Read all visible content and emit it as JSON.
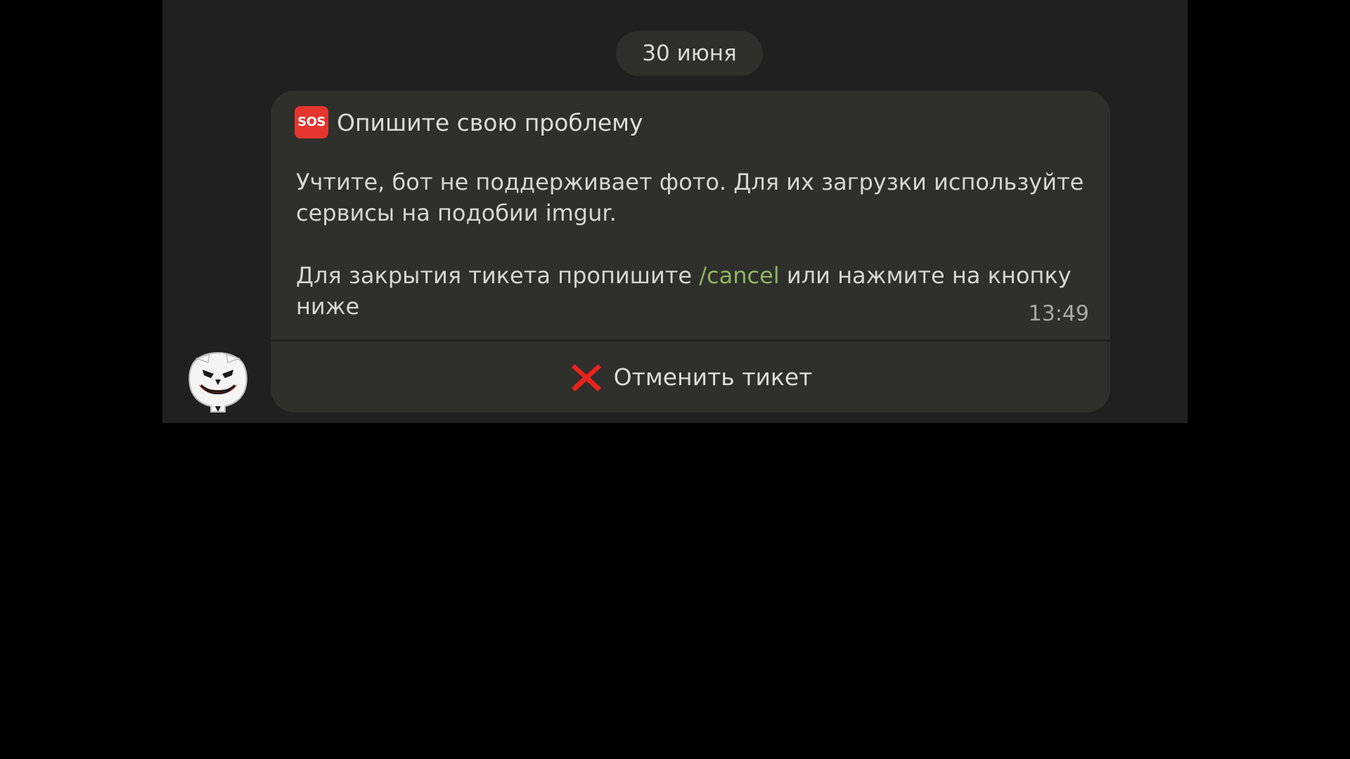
{
  "chat": {
    "date_label": "30 июня",
    "message": {
      "icon": "sos-icon",
      "title": "Опишите свою проблему",
      "paragraph1": "Учтите, бот не поддерживает фото. Для их загрузки используйте сервисы на подобии imgur.",
      "paragraph2_before": " Для закрытия тикета пропишите ",
      "command": "/cancel",
      "paragraph2_after": " или нажмите на кнопку ниже",
      "time": "13:49"
    },
    "button": {
      "icon": "cross-icon",
      "label": "Отменить тикет"
    }
  },
  "colors": {
    "background": "#000000",
    "chat_background": "#20201e",
    "bubble": "#2f2f2c",
    "text": "#d6d6d2",
    "link": "#8fb55f",
    "sos_red": "#e6352e",
    "cross_red": "#e8221c"
  }
}
